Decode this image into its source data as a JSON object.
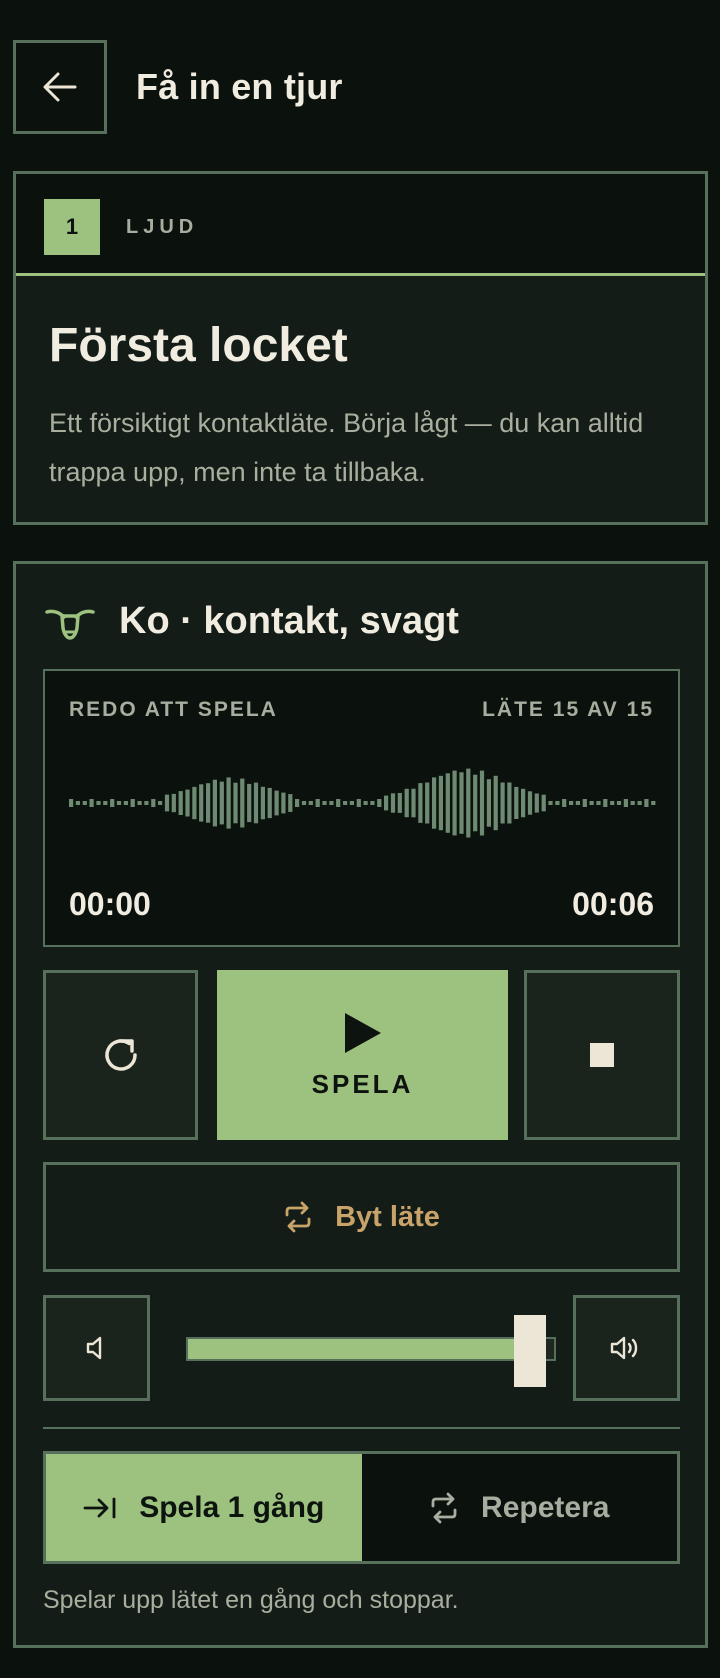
{
  "header": {
    "title": "Få in en tjur",
    "back_icon": "arrow-left-icon"
  },
  "step": {
    "number": "1",
    "label": "LJUD",
    "heading": "Första locket",
    "description": "Ett försiktigt kontaktläte. Börja lågt — du kan alltid trappa upp, men inte ta tillbaka."
  },
  "player": {
    "sound_icon": "cow-head-icon",
    "sound_title": "Ko · kontakt, svagt",
    "status": "REDO ATT SPELA",
    "count": "LÄTE 15 AV 15",
    "time_start": "00:00",
    "time_end": "00:06",
    "play_label": "SPELA",
    "swap_label": "Byt läte",
    "volume_fraction": 0.93,
    "mode_once_label": "Spela 1 gång",
    "mode_repeat_label": "Repetera",
    "mode_selected": "once",
    "mode_description": "Spelar upp lätet en gång och stoppar."
  },
  "colors": {
    "accent": "#9dc17f",
    "border": "#56705c",
    "background": "#0b110d",
    "card": "#131c16",
    "swap_text": "#c9a46a"
  }
}
